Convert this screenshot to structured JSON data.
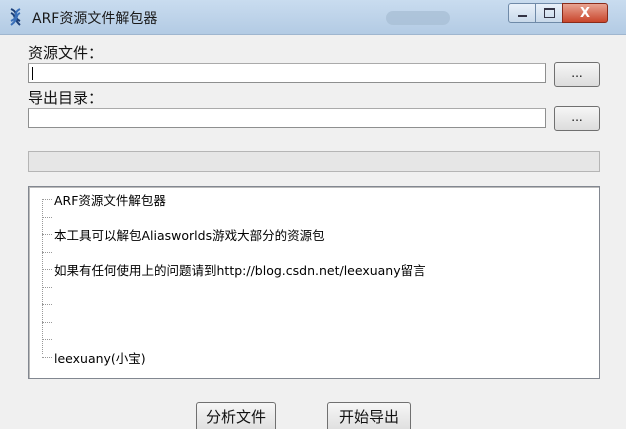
{
  "window": {
    "title": "ARF资源文件解包器",
    "close_glyph": "X",
    "icon": "app-dna-icon"
  },
  "form": {
    "source_label": "资源文件：",
    "source_value": "",
    "output_label": "导出目录：",
    "output_value": "",
    "browse_label": "..."
  },
  "progress": {
    "value": 0
  },
  "tree": {
    "items": [
      "ARF资源文件解包器",
      "",
      "本工具可以解包Aliasworlds游戏大部分的资源包",
      "",
      "如果有任何使用上的问题请到http://blog.csdn.net/leexuany留言",
      "",
      "",
      "",
      "",
      "leexuany(小宝)"
    ]
  },
  "buttons": {
    "analyze": "分析文件",
    "export": "开始导出"
  },
  "colors": {
    "titlebar": "#c0d5ec",
    "close_button": "#c9462c"
  }
}
